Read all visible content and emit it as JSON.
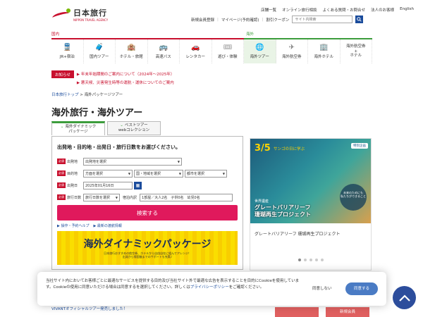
{
  "header": {
    "logo_jp": "日本旅行",
    "logo_en": "NIPPON TRAVEL AGENCY",
    "top_links": [
      "店舗一覧",
      "オンライン旅行相談",
      "よくある質問・お問合せ",
      "法人のお客様",
      "English"
    ],
    "sub_links": [
      "新規会員登録",
      "マイページ(予約確認)",
      "割引クーポン"
    ],
    "search_placeholder": "サイト内検索"
  },
  "nav": {
    "domestic_label": "国内",
    "international_label": "海外",
    "items": [
      {
        "label": "JR+宿泊",
        "icon": "train-icon",
        "glyph": "🚆"
      },
      {
        "label": "国内ツアー",
        "icon": "tour-icon",
        "glyph": "🧳"
      },
      {
        "label": "ホテル・旅館",
        "icon": "hotel-icon",
        "glyph": "🏨"
      },
      {
        "label": "高速バス",
        "icon": "bus-icon",
        "glyph": "🚌"
      },
      {
        "label": "レンタカー",
        "icon": "car-icon",
        "glyph": "🚗"
      },
      {
        "label": "遊び・体験",
        "icon": "activity-icon",
        "glyph": "🎟"
      },
      {
        "label": "海外ツアー",
        "icon": "globe-icon",
        "glyph": "🌐"
      },
      {
        "label": "海外航空券",
        "icon": "plane-icon",
        "glyph": "✈"
      },
      {
        "label": "海外ホテル",
        "icon": "building-icon",
        "glyph": "🏢"
      },
      {
        "label": "海外航空券\n+\nホテル",
        "icon": "plane-hotel-icon",
        "glyph": ""
      }
    ]
  },
  "notice": {
    "badge": "お知らせ",
    "items": [
      "年末年始期間のご案内について（2024年～2025年）",
      "悪天候、災害発生時等の運航・運休についてのご案内"
    ]
  },
  "breadcrumb": {
    "home": "日本旅行トップ",
    "sep": ">",
    "current": "海外パッケージツアー"
  },
  "page_title": "海外旅行・海外ツアー",
  "tabs": [
    {
      "line1": "海外ダイナミック",
      "line2": "パッケージ"
    },
    {
      "line1": "ベストツアー",
      "line2": "webコレクション"
    }
  ],
  "form": {
    "title": "出発地・目的地・出発日・旅行日数をお選びください。",
    "required": "必須",
    "departure_label": "出発地",
    "departure_value": "出発地を選択",
    "destination_label": "目的地",
    "direction_value": "方面を選択",
    "region_value": "国・地域を選択",
    "city_value": "都市を選択",
    "date_label": "出発日",
    "date_value": "2025年01月16日",
    "days_label": "旅行日数",
    "days_value": "旅行日数を選択",
    "room_label": "宿泊内訳",
    "room_value": "1部屋／大人2名　子供0名　幼児0名",
    "submit": "検索する",
    "help_link": "操作・予約ヘルプ",
    "recent_link": "最新の渡航情報",
    "banner_title": "海外ダイナミックパッケージ",
    "banner_sub": "日本旅行おすすめの航空券、ホテルから自由自在に組んでアレンジ！\n出発から帰国後までのサポートも充実♪"
  },
  "promo": {
    "date": "3/5",
    "date_sub": "サンゴの日に学ぶ",
    "badge": "特別企画",
    "bubble": "未来のためにも\n私たちができること",
    "cap_small": "世界遺産",
    "cap_line1": "グレートバリアリーフ",
    "cap_line2": "珊瑚再生プロジェクト",
    "caption": "グレートバリアリーフ 珊瑚再生プロジェクト",
    "dots": 5,
    "active_dot": 0
  },
  "below": {
    "link": "VIVANTオフィシャルツアー発売しました！",
    "btn1": "",
    "btn2": "新規会員"
  },
  "cookie": {
    "text": "当社サイト内においてお客様ごとに最適なサービスを提供する目的及び当社サイト外で最適な広告を表示することを目的にCookieを使用しています。Cookieの使用に同意いただける場合は同意するを選択してください。詳しくは",
    "link": "プライバシーポリシー",
    "text_end": "をご確認ください。",
    "decline": "同意しない",
    "accept": "同意する"
  }
}
